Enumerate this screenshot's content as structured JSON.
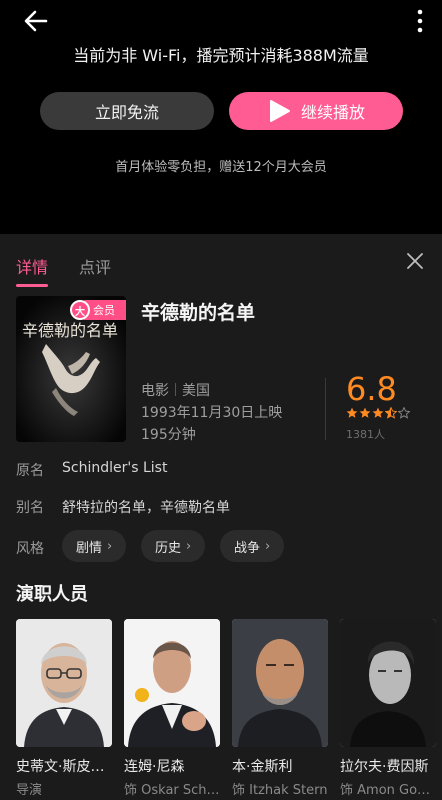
{
  "player": {
    "notice": "当前为非 Wi-Fi，播完预计消耗388M流量",
    "free_button": "立即免流",
    "play_button": "继续播放",
    "subnotice": "首月体验零负担，赠送12个月大会员"
  },
  "tabs": [
    {
      "label": "详情",
      "active": true
    },
    {
      "label": "点评",
      "active": false
    }
  ],
  "movie": {
    "title": "辛德勒的名单",
    "vip_badge": "会员",
    "vip_badge_icon": "大",
    "type": "电影",
    "region": "美国",
    "release": "1993年11月30日上映",
    "duration": "195分钟",
    "score": "6.8",
    "stars": 3.5,
    "rating_count": "1381人",
    "poster_title": "辛德勒的名单"
  },
  "info": {
    "original_name_label": "原名",
    "original_name": "Schindler's List",
    "alias_label": "别名",
    "alias": "舒特拉的名单，辛德勒名单",
    "genre_label": "风格",
    "genres": [
      "剧情",
      "历史",
      "战争"
    ]
  },
  "cast": {
    "title": "演职人员",
    "members": [
      {
        "name": "史蒂文·斯皮尔伯格",
        "role": "导演"
      },
      {
        "name": "连姆·尼森",
        "role": "饰 Oskar Schindler"
      },
      {
        "name": "本·金斯利",
        "role": "饰 Itzhak Stern"
      },
      {
        "name": "拉尔夫·费因斯",
        "role": "饰 Amon Goeth"
      }
    ]
  },
  "colors": {
    "accent": "#ff5c93",
    "score": "#ff8a22",
    "panel_bg": "#1b1b1b"
  }
}
